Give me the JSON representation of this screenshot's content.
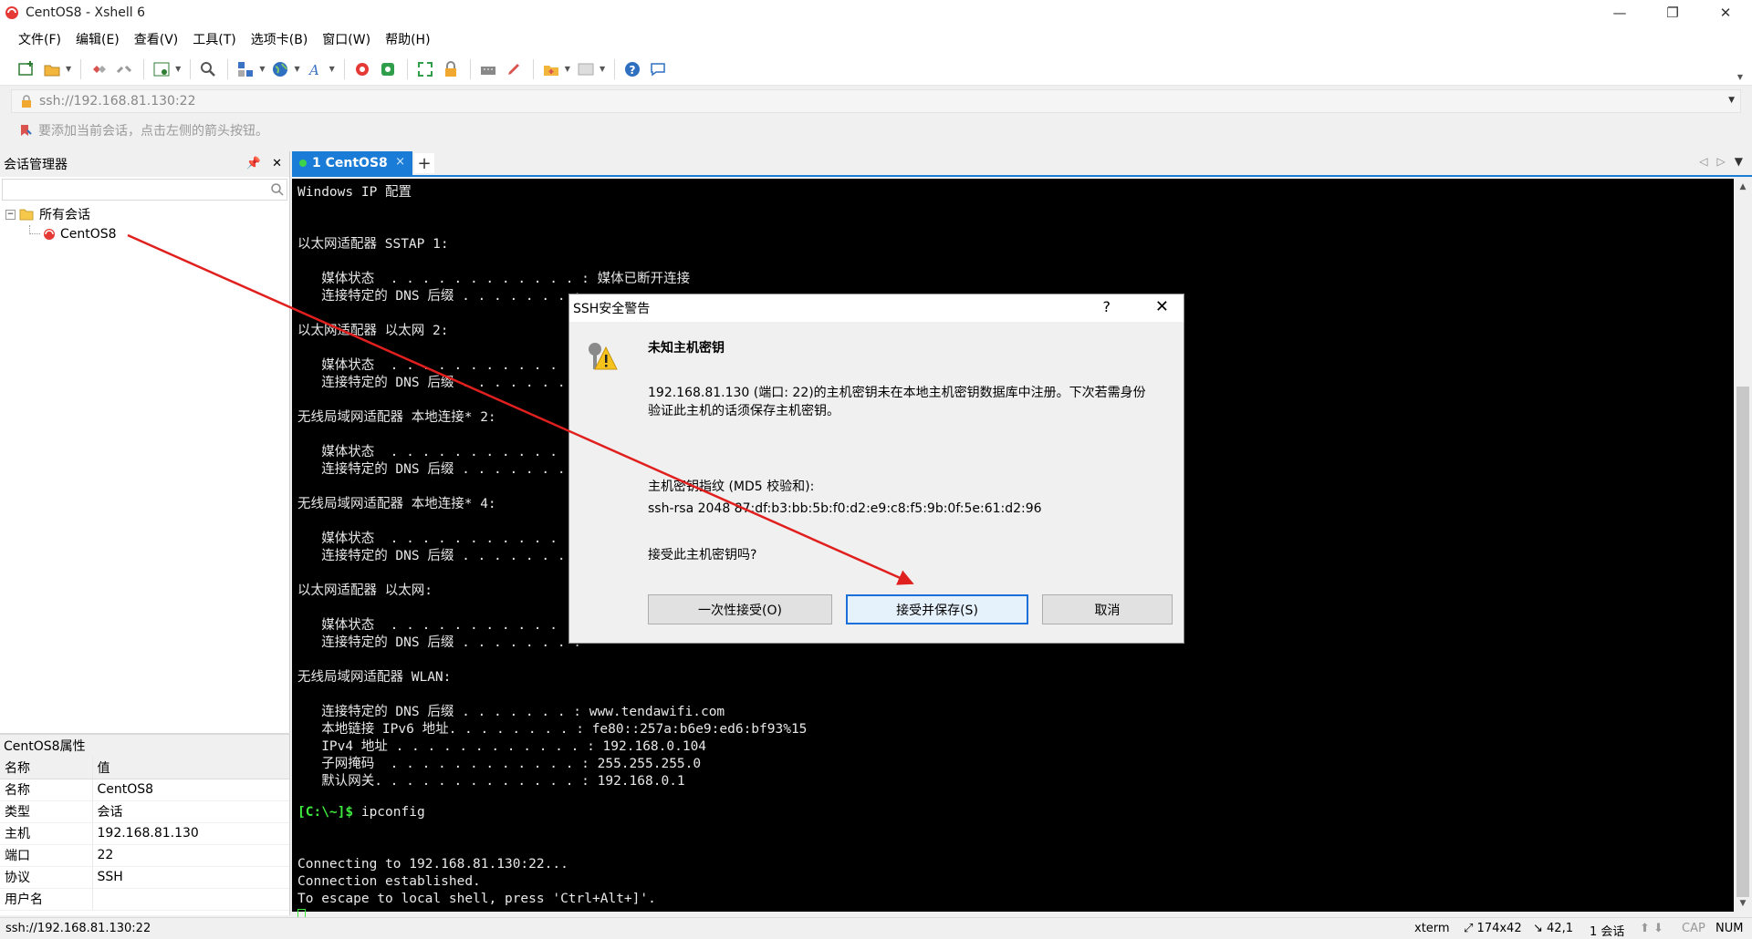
{
  "window": {
    "title": "CentOS8 - Xshell 6",
    "controls": [
      "—",
      "❐",
      "✕"
    ]
  },
  "menu": [
    "文件(F)",
    "编辑(E)",
    "查看(V)",
    "工具(T)",
    "选项卡(B)",
    "窗口(W)",
    "帮助(H)"
  ],
  "address": {
    "value": "ssh://192.168.81.130:22"
  },
  "hint": {
    "text": "要添加当前会话，点击左侧的箭头按钮。"
  },
  "session_manager": {
    "title": "会话管理器",
    "tree": {
      "root": "所有会话",
      "child": "CentOS8"
    }
  },
  "properties": {
    "title": "CentOS8属性",
    "header": {
      "name": "名称",
      "value": "值"
    },
    "rows": [
      {
        "name": "名称",
        "value": "CentOS8"
      },
      {
        "name": "类型",
        "value": "会话"
      },
      {
        "name": "主机",
        "value": "192.168.81.130"
      },
      {
        "name": "端口",
        "value": "22"
      },
      {
        "name": "协议",
        "value": "SSH"
      },
      {
        "name": "用户名",
        "value": ""
      }
    ]
  },
  "tab": {
    "label": "1 CentOS8",
    "close": "×",
    "add": "+"
  },
  "terminal": {
    "lines": [
      "Windows IP 配置",
      "",
      "",
      "以太网适配器 SSTAP 1:",
      "",
      "   媒体状态  . . . . . . . . . . . . : 媒体已断开连接",
      "   连接特定的 DNS 后缀 . . . . . . . :",
      "",
      "以太网适配器 以太网 2:",
      "",
      "   媒体状态  . . . . . . . . . . . . :",
      "   连接特定的 DNS 后缀 . . . . . . . :",
      "",
      "无线局域网适配器 本地连接* 2:",
      "",
      "   媒体状态  . . . . . . . . . . . . :",
      "   连接特定的 DNS 后缀 . . . . . . . :",
      "",
      "无线局域网适配器 本地连接* 4:",
      "",
      "   媒体状态  . . . . . . . . . . . . :",
      "   连接特定的 DNS 后缀 . . . . . . . :",
      "",
      "以太网适配器 以太网:",
      "",
      "   媒体状态  . . . . . . . . . . . . :",
      "   连接特定的 DNS 后缀 . . . . . . . :",
      "",
      "无线局域网适配器 WLAN:",
      "",
      "   连接特定的 DNS 后缀 . . . . . . . : www.tendawifi.com",
      "   本地链接 IPv6 地址. . . . . . . . : fe80::257a:b6e9:ed6:bf93%15",
      "   IPv4 地址 . . . . . . . . . . . . : 192.168.0.104",
      "   子网掩码  . . . . . . . . . . . . : 255.255.255.0",
      "   默认网关. . . . . . . . . . . . . : 192.168.0.1",
      "",
      "",
      "",
      "Connecting to 192.168.81.130:22...",
      "Connection established.",
      "To escape to local shell, press 'Ctrl+Alt+]'."
    ],
    "prompt": "[C:\\~]$",
    "command": " ipconfig"
  },
  "dialog": {
    "title": "SSH安全警告",
    "help": "?",
    "close": "✕",
    "heading": "未知主机密钥",
    "message_line1": "192.168.81.130 (端口: 22)的主机密钥未在本地主机密钥数据库中注册。下次若需身份",
    "message_line2": "验证此主机的话须保存主机密钥。",
    "fingerprint_label": "主机密钥指纹 (MD5 校验和):",
    "fingerprint": "ssh-rsa 2048 87:df:b3:bb:5b:f0:d2:e9:c8:f5:9b:0f:5e:61:d2:96",
    "question": "接受此主机密钥吗?",
    "buttons": {
      "accept_once": "一次性接受(O)",
      "accept_save": "接受并保存(S)",
      "cancel": "取消"
    }
  },
  "status": {
    "path": "ssh://192.168.81.130:22",
    "term": "xterm",
    "size": "174x42",
    "pos": "42,1",
    "sessions": "1 会话",
    "cap": "CAP",
    "num": "NUM"
  },
  "colors": {
    "accent": "#1a7cd6",
    "prompt": "#3ee83e",
    "arrow": "#e0201e"
  }
}
